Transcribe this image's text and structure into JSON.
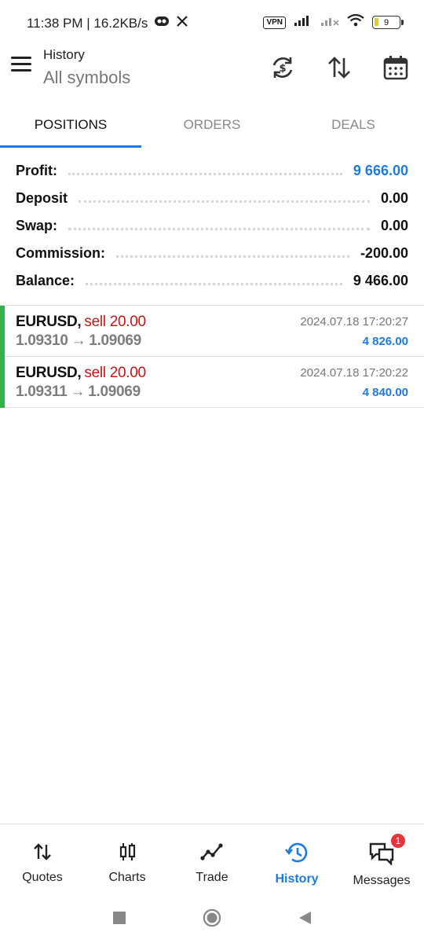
{
  "status_bar": {
    "time_speed": "11:38 PM | 16.2KB/s",
    "vpn_label": "VPN",
    "battery": "9"
  },
  "header": {
    "title": "History",
    "subtitle": "All symbols"
  },
  "tabs": [
    {
      "label": "POSITIONS",
      "active": true
    },
    {
      "label": "ORDERS",
      "active": false
    },
    {
      "label": "DEALS",
      "active": false
    }
  ],
  "summary": {
    "profit_label": "Profit:",
    "profit_value": "9 666.00",
    "deposit_label": "Deposit",
    "deposit_value": "0.00",
    "swap_label": "Swap:",
    "swap_value": "0.00",
    "commission_label": "Commission:",
    "commission_value": "-200.00",
    "balance_label": "Balance:",
    "balance_value": "9 466.00"
  },
  "positions": [
    {
      "symbol": "EURUSD,",
      "side": "sell 20.00",
      "open_price": "1.09310",
      "arrow": "→",
      "close_price": "1.09069",
      "time": "2024.07.18 17:20:27",
      "profit": "4 826.00"
    },
    {
      "symbol": "EURUSD,",
      "side": "sell 20.00",
      "open_price": "1.09311",
      "arrow": "→",
      "close_price": "1.09069",
      "time": "2024.07.18 17:20:22",
      "profit": "4 840.00"
    }
  ],
  "bottom_nav": [
    {
      "label": "Quotes",
      "icon": "quotes-icon"
    },
    {
      "label": "Charts",
      "icon": "charts-icon"
    },
    {
      "label": "Trade",
      "icon": "trade-icon"
    },
    {
      "label": "History",
      "icon": "history-icon",
      "active": true
    },
    {
      "label": "Messages",
      "icon": "messages-icon",
      "badge": "1"
    }
  ],
  "colors": {
    "accent_blue": "#1f7ae0",
    "sell_red": "#c0181a",
    "position_green": "#2fb34a",
    "badge_red": "#e5353b"
  }
}
